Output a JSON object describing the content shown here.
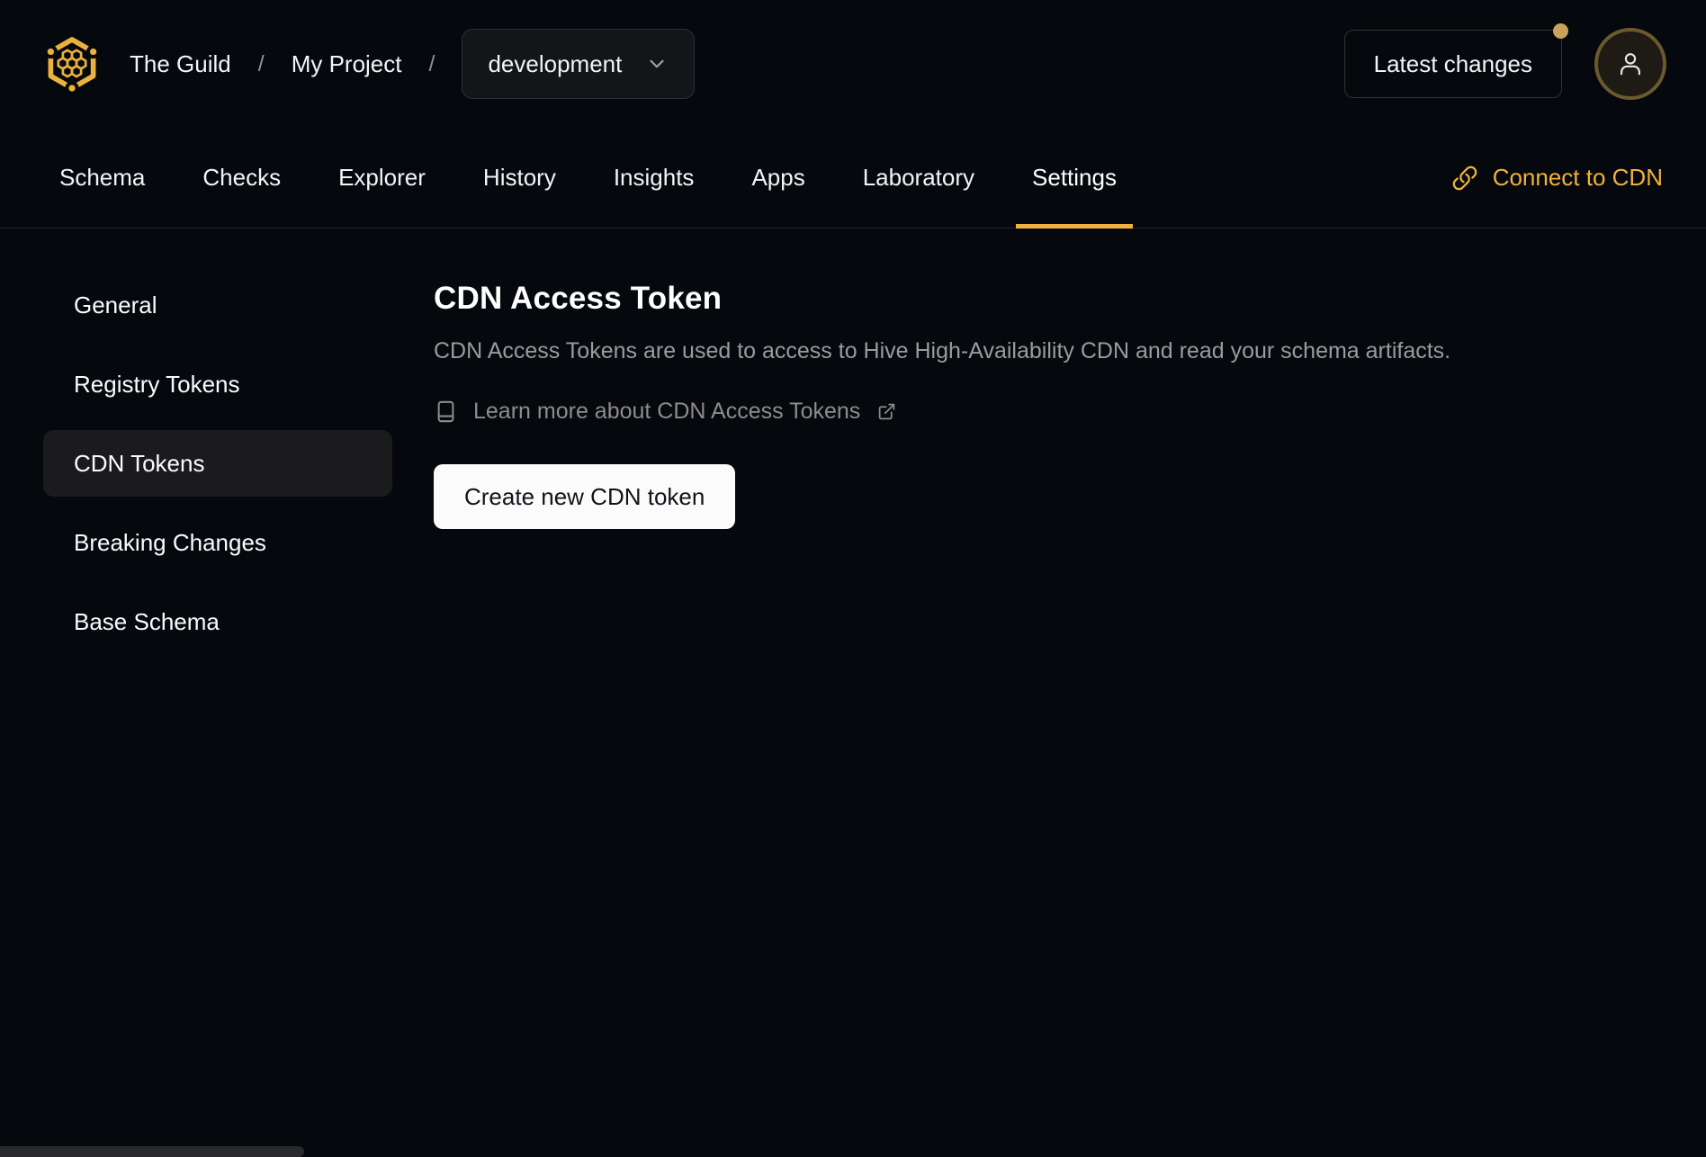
{
  "header": {
    "breadcrumb": {
      "org": "The Guild",
      "separator": "/",
      "project": "My Project"
    },
    "target_selector": {
      "value": "development"
    },
    "latest_changes_label": "Latest changes"
  },
  "tabs": {
    "items": [
      "Schema",
      "Checks",
      "Explorer",
      "History",
      "Insights",
      "Apps",
      "Laboratory",
      "Settings"
    ],
    "active": "Settings",
    "connect_cdn_label": "Connect to CDN"
  },
  "sidebar": {
    "items": [
      "General",
      "Registry Tokens",
      "CDN Tokens",
      "Breaking Changes",
      "Base Schema"
    ],
    "active": "CDN Tokens"
  },
  "main": {
    "title": "CDN Access Token",
    "description": "CDN Access Tokens are used to access to Hive High-Availability CDN and read your schema artifacts.",
    "learn_more_label": "Learn more about CDN Access Tokens",
    "create_button_label": "Create new CDN token"
  },
  "icons": {
    "logo": "hive-honeycomb-logo",
    "target_selector_chevron": "chevron-down",
    "notification": "dot-badge",
    "avatar": "user",
    "connect_cdn": "link-chain",
    "learn_more": "book",
    "learn_more_external": "external-link"
  },
  "colors": {
    "background": "#05080d",
    "accent_gold": "#f0b13d",
    "logo_gold": "#eab23d",
    "notification_dot": "#c9a35c",
    "avatar_ring": "#6d5930",
    "active_nav_background": "#1b1b1e",
    "tabbar_divider": "#26262a",
    "muted_text": "#9b9b9b",
    "link_muted_text": "#8f8c89",
    "primary_button_background": "#fbfbfb",
    "primary_button_text": "#11141a"
  }
}
